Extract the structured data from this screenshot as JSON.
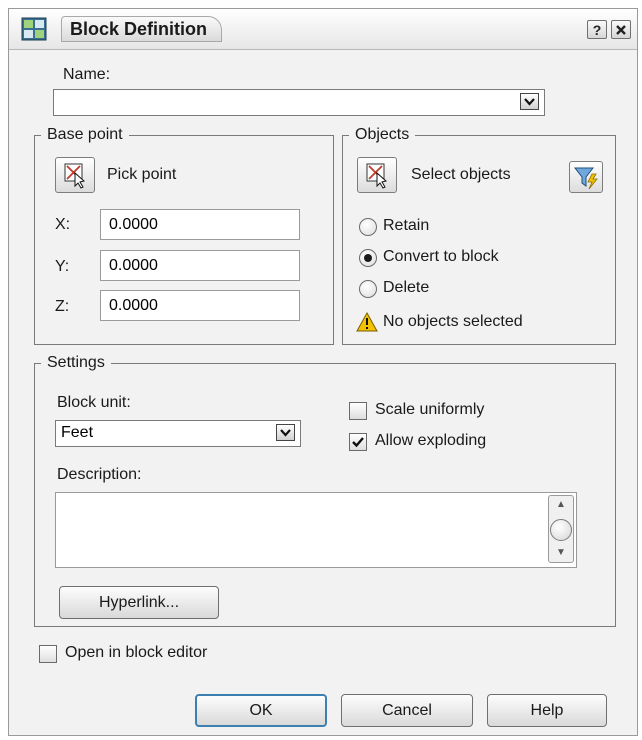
{
  "window": {
    "title": "Block Definition",
    "help_button": "?",
    "close_button": "x"
  },
  "name_field": {
    "label": "Name:",
    "value": ""
  },
  "base_point": {
    "group_title": "Base point",
    "pick_point_label": "Pick point",
    "x_label": "X:",
    "x_value": "0.0000",
    "y_label": "Y:",
    "y_value": "0.0000",
    "z_label": "Z:",
    "z_value": "0.0000"
  },
  "objects": {
    "group_title": "Objects",
    "select_objects_label": "Select objects",
    "retain_label": "Retain",
    "convert_label": "Convert to block",
    "delete_label": "Delete",
    "selected_option": "Convert to block",
    "status_text": "No objects selected"
  },
  "settings": {
    "group_title": "Settings",
    "block_unit_label": "Block unit:",
    "block_unit_value": "Feet",
    "scale_uniformly_label": "Scale uniformly",
    "scale_uniformly_checked": false,
    "allow_exploding_label": "Allow exploding",
    "allow_exploding_checked": true,
    "description_label": "Description:",
    "description_value": "",
    "hyperlink_label": "Hyperlink..."
  },
  "open_in_editor": {
    "label": "Open in block editor",
    "checked": false
  },
  "buttons": {
    "ok": "OK",
    "cancel": "Cancel",
    "help": "Help"
  },
  "colors": {
    "default_button_border": "#3c7fb1",
    "warning": "#f2c200",
    "group_border": "#7a7a7a"
  }
}
